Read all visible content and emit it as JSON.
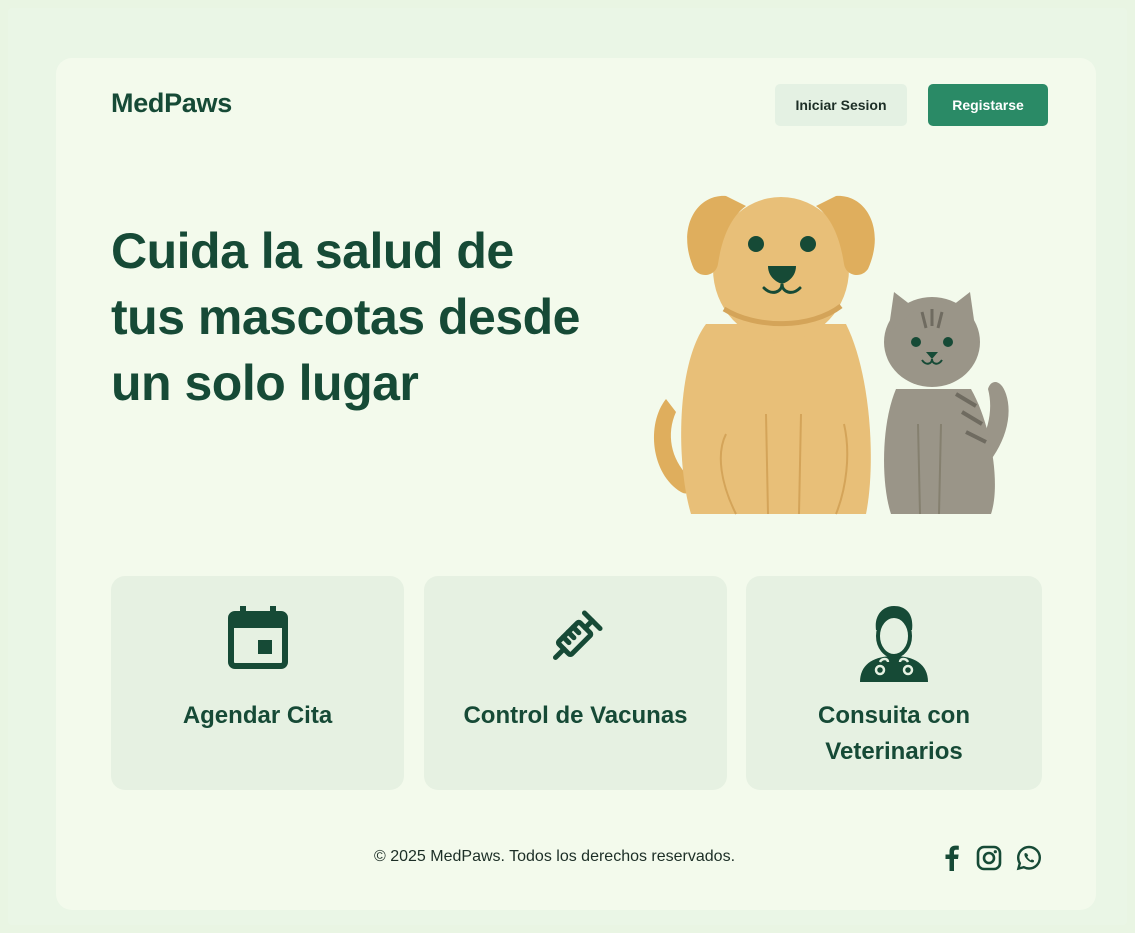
{
  "header": {
    "logo": "MedPaws",
    "login_label": "Iniciar Sesion",
    "register_label": "Registarse"
  },
  "hero": {
    "line1": "Cuida la salud de",
    "line2": "tus mascotas desde",
    "line3": "un solo lugar"
  },
  "features": [
    {
      "label": "Agendar Cita",
      "icon": "calendar-icon"
    },
    {
      "label": "Control de Vacunas",
      "icon": "syringe-icon"
    },
    {
      "label_line1": "Consuita con",
      "label_line2": "Veterinarios",
      "icon": "veterinarian-icon"
    }
  ],
  "footer": {
    "copyright": "© 2025 MedPaws. Todos los derechos reservados.",
    "social": [
      "facebook-icon",
      "instagram-icon",
      "whatsapp-icon"
    ]
  },
  "colors": {
    "primary_dark": "#164a36",
    "accent": "#2a8a66",
    "background": "#f3faec",
    "dog": "#e8bf78",
    "cat": "#9a9588"
  }
}
